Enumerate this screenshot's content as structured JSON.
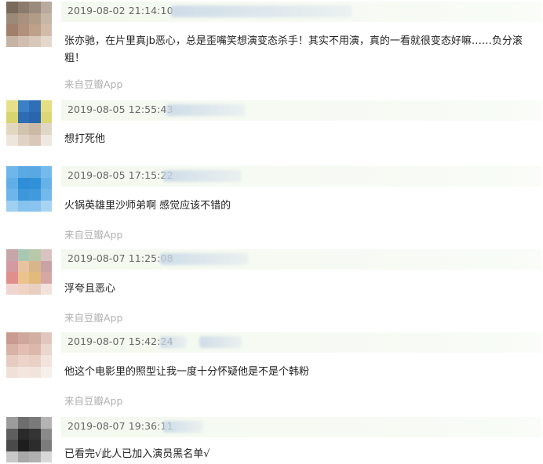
{
  "comments": [
    {
      "timestamp": "2019-08-02 21:14:10",
      "text": "张亦驰，在片里真jb恶心，总是歪嘴笑想演变态杀手！其实不用演，真的一看就很变态好嘛……负分滚粗！",
      "source": "来自豆瓣App",
      "avatar_colors": [
        "#7a6a5c",
        "#8c7b6c",
        "#9a8a7b",
        "#b8aa9c",
        "#9c8a78",
        "#a8927e",
        "#b29c88",
        "#c6b6a6",
        "#a07f6c",
        "#b2917c",
        "#bfa08a",
        "#d2bca9",
        "#c7b3a3",
        "#d0bfb0",
        "#d8c8ba",
        "#e4d8cd"
      ]
    },
    {
      "timestamp": "2019-08-05 12:55:43",
      "text": "想打死他",
      "source": "",
      "avatar_colors": [
        "#e8df8a",
        "#3b7fc4",
        "#2f6fb8",
        "#e6dc82",
        "#d8d470",
        "#2e6cb3",
        "#2a66ad",
        "#dcd676",
        "#e2d8c0",
        "#d2c2b0",
        "#cdb8a6",
        "#e0d6c6",
        "#ece6dc",
        "#e0d2c4",
        "#d9c8b8",
        "#eee8e0"
      ]
    },
    {
      "timestamp": "2019-08-05 17:15:22",
      "text": "火锅英雄里沙师弟啊 感觉应该不错的",
      "source": "来自豆瓣App",
      "avatar_colors": [
        "#6fb7ea",
        "#5aa9e4",
        "#5aa8e2",
        "#74bbec",
        "#61afe6",
        "#2f8fd6",
        "#3091d8",
        "#66b2e8",
        "#6db5ea",
        "#3e97da",
        "#4299dc",
        "#72b8eb",
        "#9fd0f2",
        "#86c3ef",
        "#88c4ef",
        "#a8d4f3"
      ]
    },
    {
      "timestamp": "2019-08-07 11:25:08",
      "text": "浮夸且恶心",
      "source": "来自豆瓣App",
      "avatar_colors": [
        "#c7a6a8",
        "#a9c8b4",
        "#b7c9a8",
        "#d8c3c0",
        "#d49aa2",
        "#e7c3a0",
        "#d9b58c",
        "#c9a2a6",
        "#e08f8c",
        "#eac48c",
        "#e3ba7c",
        "#d6a7a5",
        "#f0d6d0",
        "#efd3c4",
        "#e8cfc2",
        "#f2e2dc"
      ]
    },
    {
      "timestamp": "2019-08-07 15:42:24",
      "text": "他这个电影里的照型让我一度十分怀疑他是不是个韩粉",
      "source": "来自豆瓣App",
      "avatar_colors": [
        "#c89a90",
        "#cfa79c",
        "#d2aea3",
        "#e0c6bc",
        "#d8b2a6",
        "#e2bfb2",
        "#dcb8ab",
        "#ead6cd",
        "#e6cbc0",
        "#ecd4c9",
        "#ead0c4",
        "#f2e3dc",
        "#f0e0d8",
        "#f3e6df",
        "#f2e4dd",
        "#f7efea"
      ]
    },
    {
      "timestamp": "2019-08-07 19:36:11",
      "text": "已看完√此人已加入演员黑名单√",
      "source": "",
      "avatar_colors": [
        "#9c9c9c",
        "#6e6e6e",
        "#7a7a7a",
        "#b4b4b4",
        "#5e5e5e",
        "#2a2a2a",
        "#343434",
        "#8a8a8a",
        "#4a4a4a",
        "#1e1e1e",
        "#2c2c2c",
        "#7c7c7c",
        "#c8c8c8",
        "#a8a8a8",
        "#b0b0b0",
        "#d8d8d8"
      ]
    }
  ]
}
